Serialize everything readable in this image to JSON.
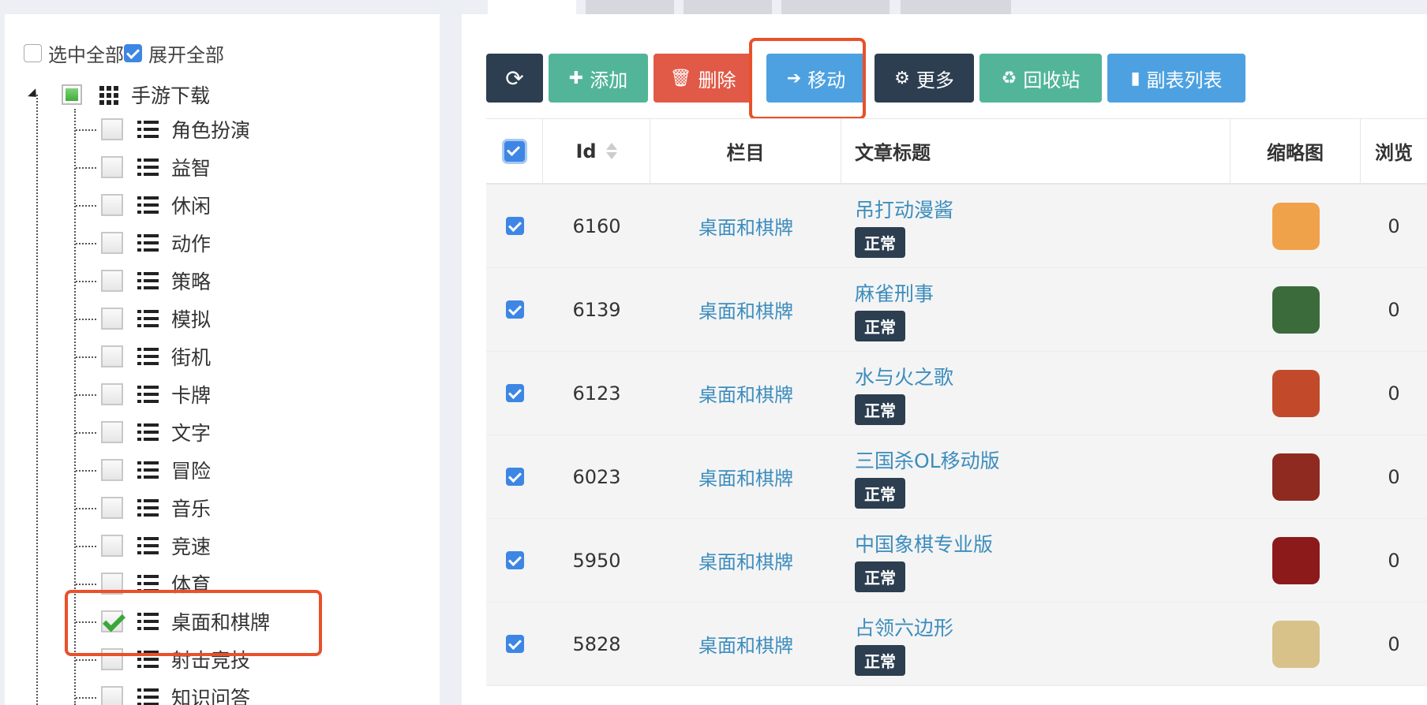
{
  "tree": {
    "select_all_label": "选中全部",
    "select_all_checked": false,
    "expand_all_label": "展开全部",
    "expand_all_checked": true,
    "root": {
      "label": "手游下载"
    },
    "children": [
      {
        "label": "角色扮演",
        "checked": false
      },
      {
        "label": "益智",
        "checked": false
      },
      {
        "label": "休闲",
        "checked": false
      },
      {
        "label": "动作",
        "checked": false
      },
      {
        "label": "策略",
        "checked": false
      },
      {
        "label": "模拟",
        "checked": false
      },
      {
        "label": "街机",
        "checked": false
      },
      {
        "label": "卡牌",
        "checked": false
      },
      {
        "label": "文字",
        "checked": false
      },
      {
        "label": "冒险",
        "checked": false
      },
      {
        "label": "音乐",
        "checked": false
      },
      {
        "label": "竞速",
        "checked": false
      },
      {
        "label": "体育",
        "checked": false
      },
      {
        "label": "桌面和棋牌",
        "checked": true
      },
      {
        "label": "射击竞技",
        "checked": false
      },
      {
        "label": "知识问答",
        "checked": false
      }
    ]
  },
  "toolbar": {
    "refresh_icon": "refresh-icon",
    "add_label": "添加",
    "delete_label": "删除",
    "move_label": "移动",
    "more_label": "更多",
    "recycle_label": "回收站",
    "subtable_label": "副表列表"
  },
  "table": {
    "headers": {
      "id": "Id",
      "column": "栏目",
      "title": "文章标题",
      "thumb": "缩略图",
      "views": "浏览"
    },
    "rows": [
      {
        "id": "6160",
        "column": "桌面和棋牌",
        "title": "吊打动漫酱",
        "status": "正常",
        "views": "0",
        "thumb_color": "#f0a24a"
      },
      {
        "id": "6139",
        "column": "桌面和棋牌",
        "title": "麻雀刑事",
        "status": "正常",
        "views": "0",
        "thumb_color": "#3b6b3a"
      },
      {
        "id": "6123",
        "column": "桌面和棋牌",
        "title": "水与火之歌",
        "status": "正常",
        "views": "0",
        "thumb_color": "#c24a2a"
      },
      {
        "id": "6023",
        "column": "桌面和棋牌",
        "title": "三国杀OL移动版",
        "status": "正常",
        "views": "0",
        "thumb_color": "#8e2a20"
      },
      {
        "id": "5950",
        "column": "桌面和棋牌",
        "title": "中国象棋专业版",
        "status": "正常",
        "views": "0",
        "thumb_color": "#8c1a1a"
      },
      {
        "id": "5828",
        "column": "桌面和棋牌",
        "title": "占领六边形",
        "status": "正常",
        "views": "0",
        "thumb_color": "#d8c28a"
      }
    ]
  },
  "colors": {
    "highlight": "#e8512a",
    "link": "#3c8dbc",
    "dark": "#2c3e50"
  }
}
